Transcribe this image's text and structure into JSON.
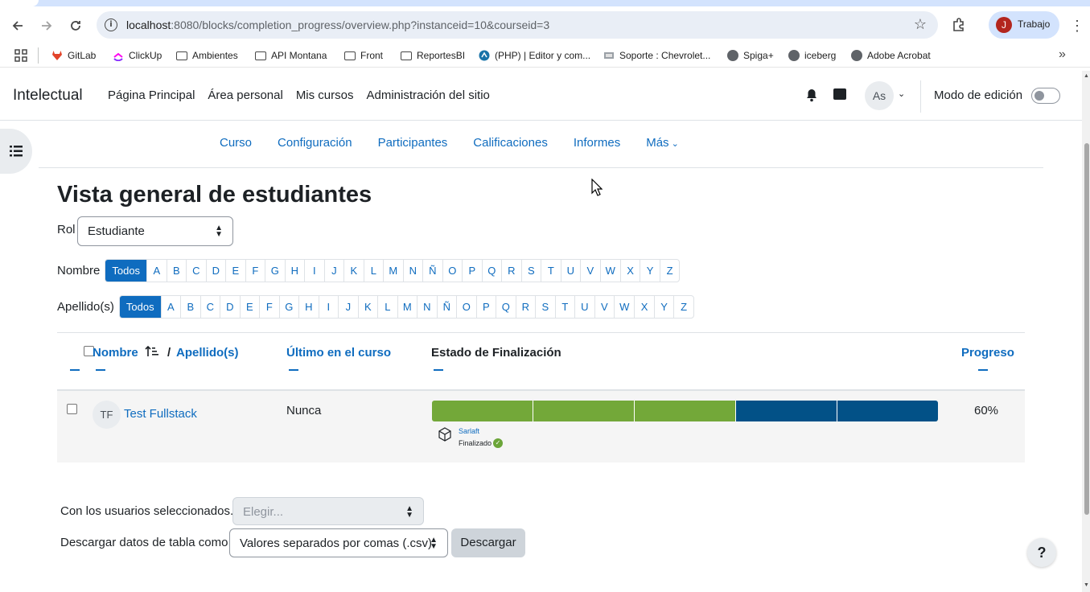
{
  "browser": {
    "url_host": "localhost",
    "url_rest": ":8080/blocks/completion_progress/overview.php?instanceid=10&courseid=3",
    "profile_initial": "J",
    "profile_name": "Trabajo",
    "bookmarks": [
      {
        "label": "GitLab",
        "icon": "gitlab-icon"
      },
      {
        "label": "ClickUp",
        "icon": "clickup-icon"
      },
      {
        "label": "Ambientes",
        "icon": "folder-icon"
      },
      {
        "label": "API Montana",
        "icon": "folder-icon"
      },
      {
        "label": "Front",
        "icon": "folder-icon"
      },
      {
        "label": "ReportesBI",
        "icon": "folder-icon"
      },
      {
        "label": "(PHP) | Editor y com...",
        "icon": "php-editor-icon"
      },
      {
        "label": "Soporte : Chevrolet...",
        "icon": "chevrolet-icon"
      },
      {
        "label": "Spiga+",
        "icon": "globe-icon"
      },
      {
        "label": "iceberg",
        "icon": "globe-icon"
      },
      {
        "label": "Adobe Acrobat",
        "icon": "globe-icon"
      }
    ]
  },
  "header": {
    "brand": "Intelectual",
    "nav": [
      "Página Principal",
      "Área personal",
      "Mis cursos",
      "Administración del sitio"
    ],
    "user_initials": "As",
    "edit_mode_label": "Modo de edición"
  },
  "secondary_nav": [
    "Curso",
    "Configuración",
    "Participantes",
    "Calificaciones",
    "Informes",
    "Más"
  ],
  "page": {
    "title": "Vista general de estudiantes",
    "role_label": "Rol",
    "role_value": "Estudiante",
    "first_name_label": "Nombre",
    "last_name_label": "Apellido(s)",
    "initials_all": "Todos",
    "letters": [
      "A",
      "B",
      "C",
      "D",
      "E",
      "F",
      "G",
      "H",
      "I",
      "J",
      "K",
      "L",
      "M",
      "N",
      "Ñ",
      "O",
      "P",
      "Q",
      "R",
      "S",
      "T",
      "U",
      "V",
      "W",
      "X",
      "Y",
      "Z"
    ]
  },
  "table": {
    "col_name": "Nombre",
    "col_sep": "/",
    "col_lastname": "Apellido(s)",
    "col_last_access": "Último en el curso",
    "col_status": "Estado de Finalización",
    "col_progress": "Progreso",
    "rows": [
      {
        "initials": "TF",
        "name": "Test Fullstack",
        "last_access": "Nunca",
        "segments": [
          "complete",
          "complete",
          "complete",
          "pending",
          "pending"
        ],
        "activity_name": "Sarlaft",
        "activity_status": "Finalizado",
        "progress": "60%"
      }
    ]
  },
  "colors": {
    "complete": "#73a839",
    "pending": "#025187",
    "link": "#0f6cbf"
  },
  "bulk": {
    "label": "Con los usuarios seleccionados...",
    "placeholder": "Elegir..."
  },
  "download": {
    "label": "Descargar datos de tabla como",
    "format": "Valores separados por comas (.csv)",
    "button": "Descargar"
  },
  "help_label": "?"
}
